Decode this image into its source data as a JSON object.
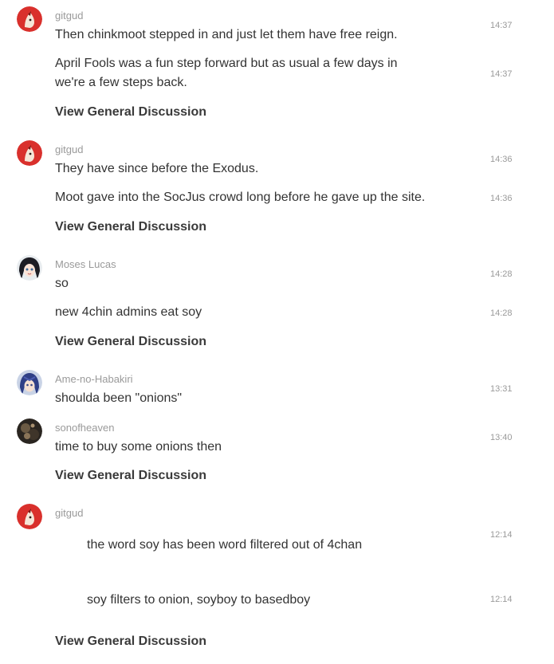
{
  "colors": {
    "author": "#9a9a9a",
    "message": "#333333",
    "time": "#9a9a9a",
    "link": "#3a3a3a",
    "avatar_red": "#d9302c"
  },
  "groups": [
    {
      "author": "gitgud",
      "avatar_icon": "red-fox-avatar-icon",
      "messages": [
        {
          "text": "Then chinkmoot stepped in and just let them have free reign.",
          "time": "14:37"
        },
        {
          "text": "April Fools was a fun step forward but as usual a few days in we're a few steps back.",
          "time": "14:37"
        }
      ],
      "link": "View General Discussion"
    },
    {
      "author": "gitgud",
      "avatar_icon": "red-fox-avatar-icon",
      "messages": [
        {
          "text": "They have since before the Exodus.",
          "time": "14:36"
        },
        {
          "text": "Moot gave into the SocJus crowd long before he gave up the site.",
          "time": "14:36"
        }
      ],
      "link": "View General Discussion"
    },
    {
      "author": "Moses Lucas",
      "avatar_icon": "anime-girl-avatar-icon",
      "messages": [
        {
          "text": "so",
          "time": "14:28"
        },
        {
          "text": "new 4chin admins eat soy",
          "time": "14:28"
        }
      ],
      "link": "View General Discussion"
    },
    {
      "author": "Ame-no-Habakiri",
      "avatar_icon": "blue-hair-avatar-icon",
      "messages": [
        {
          "text": "shoulda been \"onions\"",
          "time": "13:31"
        }
      ]
    },
    {
      "author": "sonofheaven",
      "avatar_icon": "dark-figure-avatar-icon",
      "messages": [
        {
          "text": "time to buy some onions then",
          "time": "13:40"
        }
      ],
      "link": "View General Discussion"
    },
    {
      "author": "gitgud",
      "avatar_icon": "red-fox-avatar-icon",
      "messages": [
        {
          "text": "the word soy has been word filtered out of 4chan",
          "time": "12:14"
        },
        {
          "text": "soy filters to onion, soyboy to basedboy",
          "time": "12:14"
        }
      ],
      "link": "View General Discussion"
    }
  ]
}
